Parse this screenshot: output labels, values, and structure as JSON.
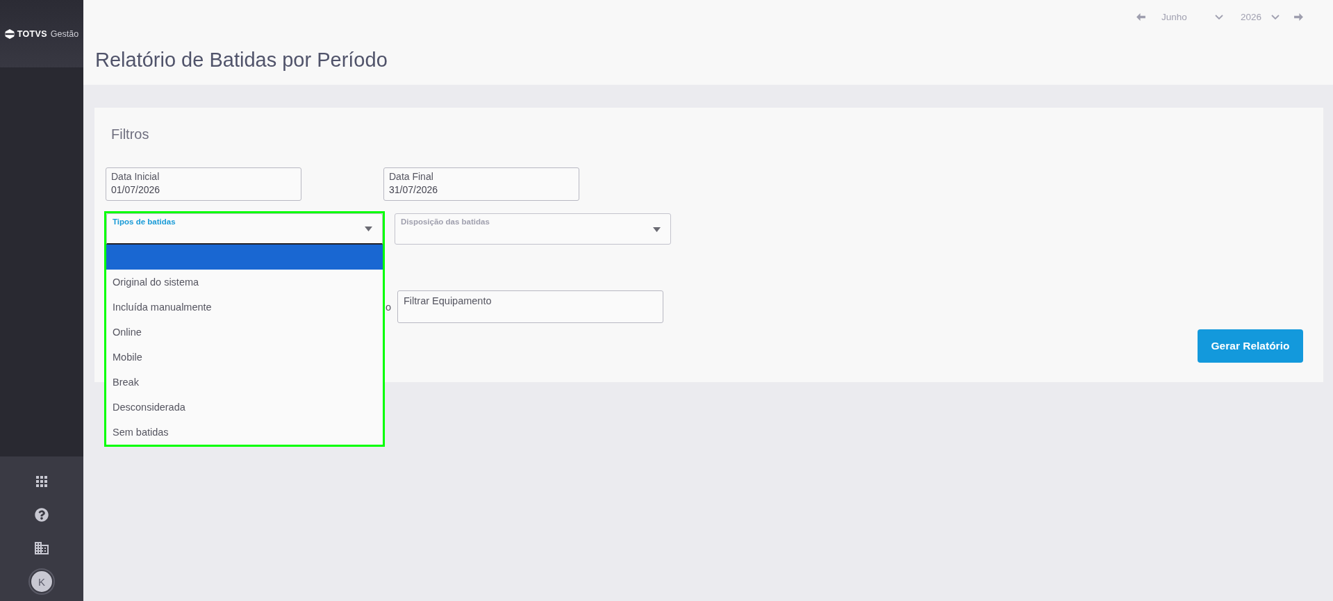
{
  "sidebar": {
    "logo": {
      "brand": "TOTVS",
      "product": "Gestão"
    },
    "avatar": {
      "initial": "K"
    }
  },
  "header": {
    "period_nav": {
      "month": "Junho",
      "year": "2026"
    },
    "title": "Relatório de Batidas por Período"
  },
  "filters": {
    "title": "Filtros",
    "date_fields": [
      {
        "label": "Data Inicial",
        "value": "01/07/2026"
      },
      {
        "label": "Data Final",
        "value": "31/07/2026"
      }
    ],
    "selects": [
      {
        "label": "Tipos de batidas",
        "expanded": true,
        "highlighted": true,
        "options": [
          {
            "selected": true
          },
          {
            "label": "Original do sistema",
            "selected": false
          },
          {
            "label": "Incluída manualmente",
            "selected": false
          },
          {
            "label": "Online",
            "selected": false
          },
          {
            "label": "Mobile",
            "selected": false
          },
          {
            "label": "Break",
            "selected": false
          },
          {
            "label": "Desconsiderada",
            "selected": false
          },
          {
            "label": "Sem batidas",
            "selected": false
          }
        ]
      },
      {
        "label": "Disposição das batidas",
        "expanded": false,
        "highlighted": false
      }
    ],
    "equipment_filter": {
      "covered_label": "o",
      "label": "Filtrar Equipamento"
    },
    "submit_button": "Gerar Relatório"
  }
}
